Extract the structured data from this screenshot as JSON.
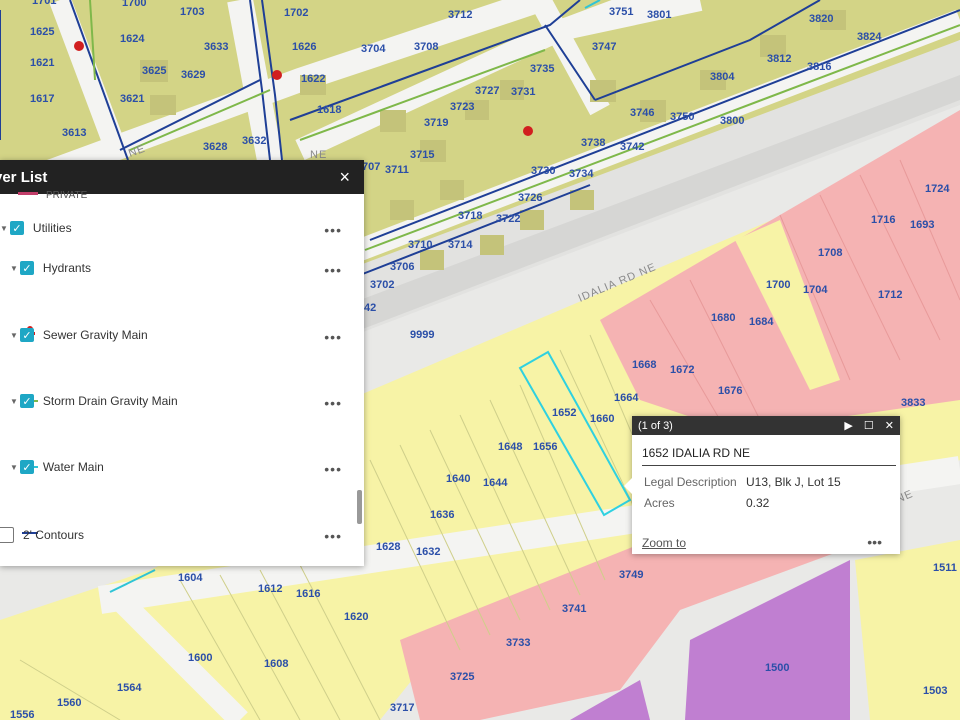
{
  "layer_list": {
    "title": "yer List",
    "close_icon": "×",
    "private_label": "PRIVATE",
    "items": [
      {
        "label": "Utilities",
        "checked": true,
        "more": "•••"
      },
      {
        "label": "Hydrants",
        "checked": true,
        "more": "•••"
      },
      {
        "label": "Sewer Gravity Main",
        "checked": true,
        "more": "•••",
        "color": "#7fb84a"
      },
      {
        "label": "Storm Drain Gravity Main",
        "checked": true,
        "more": "•••",
        "color": "#2fc4d6"
      },
      {
        "label": "Water Main",
        "checked": true,
        "more": "•••",
        "color": "#1f3f96"
      },
      {
        "label": "2' Contours",
        "checked": false,
        "more": "•••"
      }
    ]
  },
  "popup": {
    "counter": "(1 of 3)",
    "title": "1652 IDALIA RD NE",
    "attributes": [
      {
        "key": "Legal Description",
        "value": "U13, Blk J, Lot 15"
      },
      {
        "key": "Acres",
        "value": "0.32"
      }
    ],
    "zoom_label": "Zoom to",
    "more": "•••"
  },
  "map": {
    "roads": [
      "IDALIA RD NE",
      "NE",
      "NE",
      "NE"
    ],
    "colors": {
      "residential_yellow": "#f7f3a6",
      "olive": "#d3d486",
      "commercial_pink": "#f5b3b3",
      "institutional_purple": "#c07fd1",
      "road": "#e9e9e7"
    },
    "parcel_labels": [
      "1701",
      "1700",
      "1703",
      "1702",
      "3712",
      "3751",
      "3801",
      "3820",
      "1625",
      "1624",
      "1626",
      "3704",
      "3708",
      "3747",
      "3824",
      "1621",
      "3633",
      "3735",
      "3812",
      "3816",
      "3625",
      "3629",
      "1622",
      "3804",
      "1617",
      "3621",
      "3727",
      "3731",
      "1618",
      "3723",
      "3746",
      "3750",
      "3800",
      "3613",
      "3719",
      "3738",
      "3742",
      "3628",
      "3632",
      "3715",
      "707",
      "3711",
      "3730",
      "3734",
      "3726",
      "1724",
      "3718",
      "3722",
      "1716",
      "1693",
      "3710",
      "3714",
      "3706",
      "1708",
      "1700",
      "1704",
      "1712",
      "3702",
      "42",
      "9999",
      "1680",
      "1684",
      "1668",
      "1672",
      "1676",
      "1664",
      "3833",
      "1652",
      "1660",
      "1648",
      "1656",
      "1640",
      "1644",
      "1636",
      "1628",
      "1632",
      "1604",
      "1612",
      "1616",
      "1620",
      "3749",
      "1511",
      "3741",
      "3733",
      "1600",
      "1608",
      "1500",
      "1564",
      "3725",
      "1503",
      "1556",
      "1560",
      "3717"
    ]
  }
}
